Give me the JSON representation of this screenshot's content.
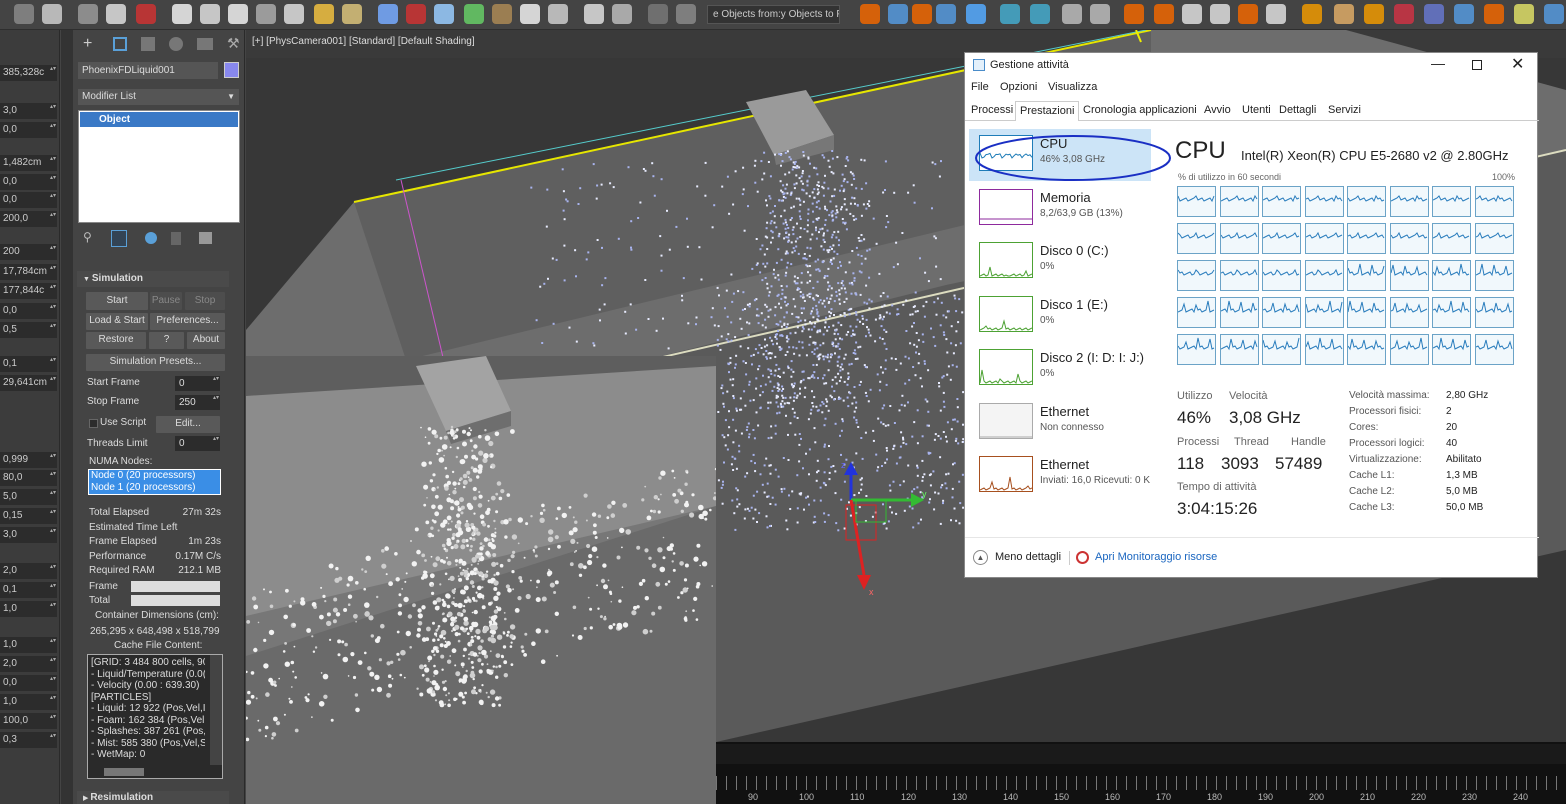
{
  "toolbar": {
    "filter_text": "e Objects from:y Objects to F"
  },
  "left_fields": [
    "385,328c",
    "3,0",
    "0,0",
    "1,482cm",
    "0,0",
    "0,0",
    "200,0",
    "200",
    "17,784cm",
    "177,844c",
    "0,0",
    "0,5",
    "0,1",
    "29,641cm",
    "0,999",
    "80,0",
    "5,0",
    "0,15",
    "3,0",
    "2,0",
    "0,1",
    "1,0",
    "1,0",
    "2,0",
    "0,0",
    "1,0",
    "100,0",
    "0,3"
  ],
  "command_panel": {
    "object_name": "PhoenixFDLiquid001",
    "modifier_list": "Modifier List",
    "stack_item": "Object",
    "simulation_title": "Simulation",
    "buttons": {
      "start": "Start",
      "pause": "Pause",
      "stop": "Stop",
      "load_start": "Load & Start",
      "preferences": "Preferences...",
      "restore": "Restore",
      "help": "?",
      "about": "About",
      "presets": "Simulation Presets...",
      "edit": "Edit..."
    },
    "start_frame_label": "Start Frame",
    "start_frame": "0",
    "stop_frame_label": "Stop Frame",
    "stop_frame": "250",
    "use_script": "Use Script",
    "threads_label": "Threads Limit",
    "threads": "0",
    "numa_label": "NUMA Nodes:",
    "numa_nodes": [
      "Node 0 (20 processors)",
      "Node 1 (20 processors)"
    ],
    "stats": [
      {
        "label": "Total Elapsed",
        "value": "27m 32s"
      },
      {
        "label": "Estimated Time Left",
        "value": ""
      },
      {
        "label": "Frame Elapsed",
        "value": "1m 23s"
      },
      {
        "label": "Performance",
        "value": "0.17M C/s"
      },
      {
        "label": "Required RAM",
        "value": "212.1 MB"
      }
    ],
    "frame_label": "Frame",
    "total_label": "Total",
    "container_label": "Container Dimensions (cm):",
    "container_dims": "265,295 x 648,498 x 518,799",
    "cache_label": "Cache File Content:",
    "cache_lines": [
      "[GRID: 3 484 800 cells, 90",
      "- Liquid/Temperature (0.0(",
      "- Velocity (0.00 : 639.30)",
      "[PARTICLES]",
      "- Liquid: 12 922 (Pos,Vel,I",
      "- Foam: 162 384 (Pos,Vel,",
      "- Splashes: 387 261 (Pos,'",
      "- Mist: 585 380 (Pos,Vel,S",
      "- WetMap: 0"
    ],
    "resim_title": "Resimulation"
  },
  "viewport": {
    "label": "[+] [PhysCamera001] [Standard] [Default Shading]",
    "gizmo_labels": [
      "z",
      "y",
      "x"
    ]
  },
  "timeline": {
    "ticks": [
      "90",
      "100",
      "110",
      "120",
      "130",
      "140",
      "150",
      "160",
      "170",
      "180",
      "190",
      "200",
      "210",
      "220",
      "230",
      "240"
    ]
  },
  "taskmgr": {
    "title": "Gestione attività",
    "menu": [
      "File",
      "Opzioni",
      "Visualizza"
    ],
    "tabs": [
      "Processi",
      "Prestazioni",
      "Cronologia applicazioni",
      "Avvio",
      "Utenti",
      "Dettagli",
      "Servizi"
    ],
    "active_tab": "Prestazioni",
    "sidebar": [
      {
        "name": "CPU",
        "detail": "46% 3,08 GHz",
        "color": "#1e7cb8"
      },
      {
        "name": "Memoria",
        "detail": "8,2/63,9 GB (13%)",
        "color": "#8e2a9d"
      },
      {
        "name": "Disco 0 (C:)",
        "detail": "0%",
        "color": "#4da234"
      },
      {
        "name": "Disco 1 (E:)",
        "detail": "0%",
        "color": "#4da234"
      },
      {
        "name": "Disco 2 (I: D: I: J:)",
        "detail": "0%",
        "color": "#4da234"
      },
      {
        "name": "Ethernet",
        "detail": "Non connesso",
        "color": "#aaaaaa"
      },
      {
        "name": "Ethernet",
        "detail": "Inviati: 16,0 Ricevuti: 0 K",
        "color": "#a7501f"
      }
    ],
    "cpu_heading": "CPU",
    "cpu_model": "Intel(R) Xeon(R) CPU E5-2680 v2 @ 2.80GHz",
    "graph_label": "% di utilizzo in 60 secondi",
    "graph_max": "100%",
    "stats": {
      "utilizzo_label": "Utilizzo",
      "utilizzo": "46%",
      "velocita_label": "Velocità",
      "velocita": "3,08 GHz",
      "processi_label": "Processi",
      "processi": "118",
      "thread_label": "Thread",
      "thread": "3093",
      "handle_label": "Handle",
      "handle": "57489",
      "uptime_label": "Tempo di attività",
      "uptime": "3:04:15:26"
    },
    "right_stats": [
      {
        "label": "Velocità massima:",
        "value": "2,80 GHz"
      },
      {
        "label": "Processori fisici:",
        "value": "2"
      },
      {
        "label": "Cores:",
        "value": "20"
      },
      {
        "label": "Processori logici:",
        "value": "40"
      },
      {
        "label": "Virtualizzazione:",
        "value": "Abilitato"
      },
      {
        "label": "Cache L1:",
        "value": "1,3 MB"
      },
      {
        "label": "Cache L2:",
        "value": "5,0 MB"
      },
      {
        "label": "Cache L3:",
        "value": "50,0 MB"
      }
    ],
    "less_details": "Meno dettagli",
    "open_monitor": "Apri Monitoraggio risorse"
  }
}
